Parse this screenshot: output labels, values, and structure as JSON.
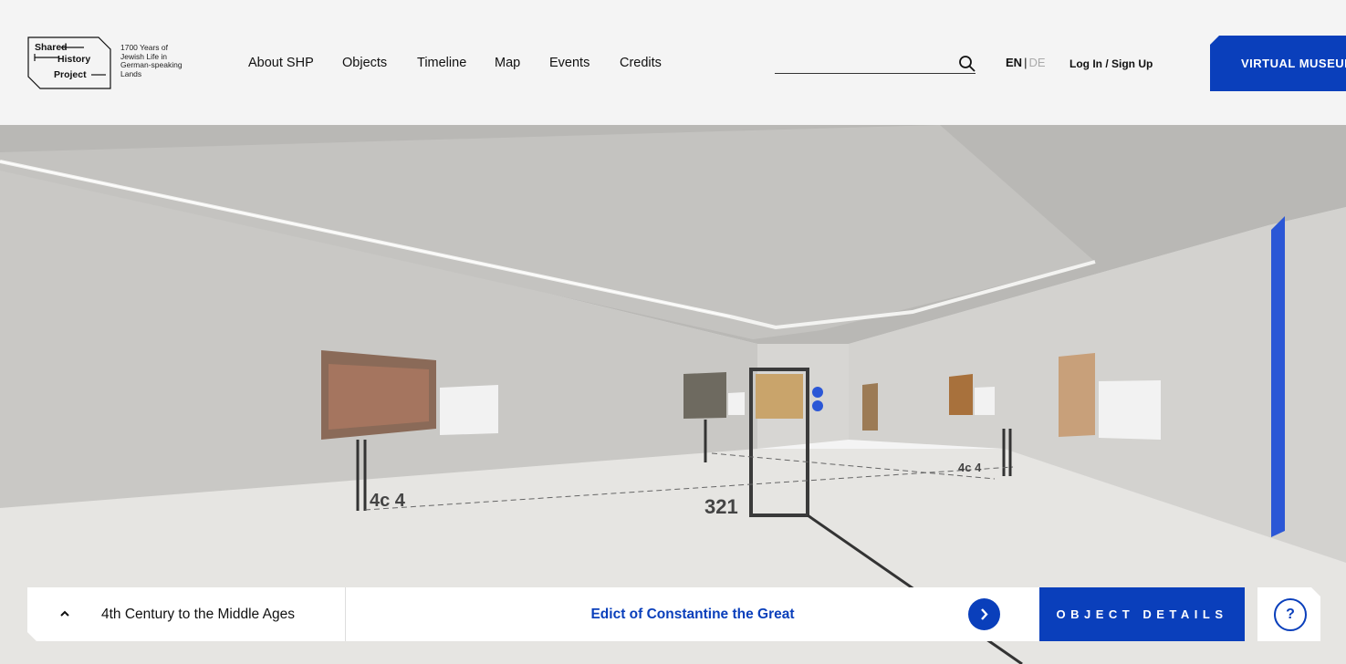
{
  "header": {
    "logo": {
      "line1": "Shared",
      "line2": "History",
      "line3": "Project"
    },
    "tagline": [
      "1700 Years of",
      "Jewish Life in",
      "German-speaking",
      "Lands"
    ],
    "nav": [
      "About SHP",
      "Objects",
      "Timeline",
      "Map",
      "Events",
      "Credits"
    ],
    "search": {
      "value": "",
      "placeholder": ""
    },
    "lang": {
      "active": "EN",
      "separator": "|",
      "inactive": "DE"
    },
    "login": "Log In / Sign Up",
    "virtual_museum": "VIRTUAL MUSEUM"
  },
  "scene": {
    "floor_labels": {
      "left": "4c 4",
      "center": "321",
      "right": "4c 4"
    }
  },
  "bottom_bar": {
    "section": "4th Century to the Middle Ages",
    "object": "Edict of Constantine the Great",
    "details": "OBJECT DETAILS",
    "help": "?"
  },
  "colors": {
    "accent": "#0a3fbb",
    "header_bg": "#f4f4f4"
  },
  "icons": [
    "search-icon",
    "chevron-up-icon",
    "chevron-right-icon",
    "help-icon"
  ]
}
